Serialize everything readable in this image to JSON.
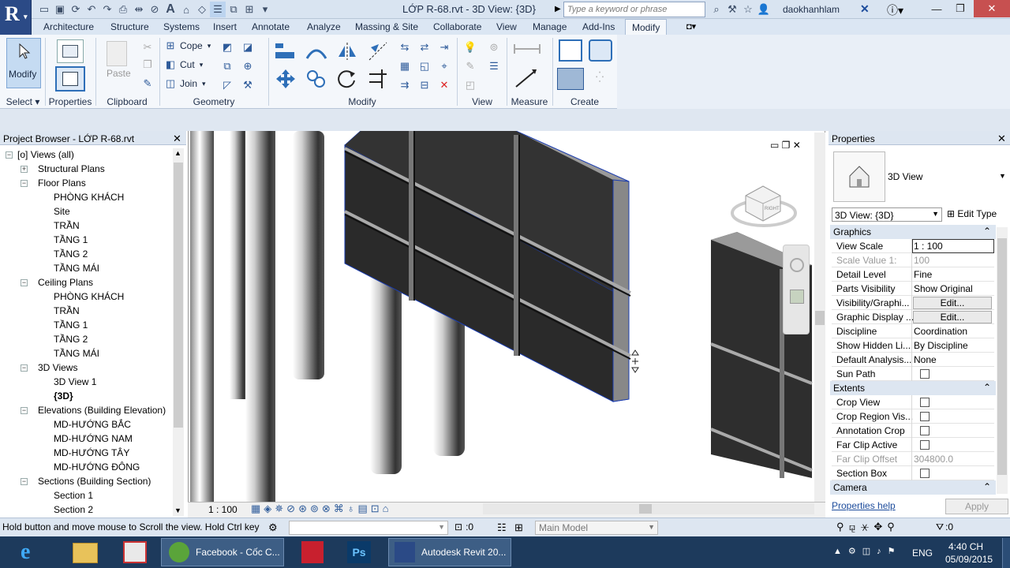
{
  "app": {
    "logo_letter": "R",
    "document_title": "LỚP R-68.rvt - 3D View: {3D}",
    "search_placeholder": "Type a keyword or phrase",
    "user": "daokhanhlam"
  },
  "tabs": [
    "Architecture",
    "Structure",
    "Systems",
    "Insert",
    "Annotate",
    "Analyze",
    "Massing & Site",
    "Collaborate",
    "View",
    "Manage",
    "Add-Ins",
    "Modify"
  ],
  "ribbon": {
    "modify_label": "Modify",
    "properties_label": "Properties",
    "paste_label": "Paste",
    "cope": "Cope",
    "cut": "Cut",
    "join": "Join",
    "panels": {
      "select": "Select ▾",
      "properties": "Properties",
      "clipboard": "Clipboard",
      "geometry": "Geometry",
      "modify": "Modify",
      "view": "View",
      "measure": "Measure",
      "create": "Create"
    }
  },
  "project_browser": {
    "title": "Project Browser - LỚP R-68.rvt",
    "items": [
      "Views (all)",
      "Structural Plans",
      "Floor Plans",
      "PHÒNG KHÁCH",
      "Site",
      "TRẦN",
      "TẦNG 1",
      "TẦNG 2",
      "TẦNG MÁI",
      "Ceiling Plans",
      "PHÒNG KHÁCH",
      "TRẦN",
      "TẦNG 1",
      "TẦNG 2",
      "TẦNG MÁI",
      "3D Views",
      "3D View 1",
      "{3D}",
      "Elevations (Building Elevation)",
      "MD-HƯỚNG BẮC",
      "MD-HƯỚNG NAM",
      "MD-HƯỚNG TÂY",
      "MD-HƯỚNG ĐÔNG",
      "Sections (Building Section)",
      "Section 1",
      "Section 2"
    ]
  },
  "viewport": {
    "scale": "1 : 100",
    "cube_label": "RIGHT"
  },
  "properties": {
    "title": "Properties",
    "type_name": "3D View",
    "instance_selector": "3D View: {3D}",
    "edit_type": "Edit Type",
    "cat_graphics": "Graphics",
    "cat_extents": "Extents",
    "cat_camera": "Camera",
    "rows": [
      {
        "k": "View Scale",
        "v": "1 : 100"
      },
      {
        "k": "Scale Value    1:",
        "v": "100"
      },
      {
        "k": "Detail Level",
        "v": "Fine"
      },
      {
        "k": "Parts Visibility",
        "v": "Show Original"
      },
      {
        "k": "Visibility/Graphi...",
        "v": "Edit..."
      },
      {
        "k": "Graphic Display ...",
        "v": "Edit..."
      },
      {
        "k": "Discipline",
        "v": "Coordination"
      },
      {
        "k": "Show Hidden Li...",
        "v": "By Discipline"
      },
      {
        "k": "Default Analysis...",
        "v": "None"
      },
      {
        "k": "Sun Path",
        "v": ""
      },
      {
        "k": "Crop View",
        "v": ""
      },
      {
        "k": "Crop Region Vis...",
        "v": ""
      },
      {
        "k": "Annotation Crop",
        "v": ""
      },
      {
        "k": "Far Clip Active",
        "v": ""
      },
      {
        "k": "Far Clip Offset",
        "v": "304800.0"
      },
      {
        "k": "Section Box",
        "v": ""
      }
    ],
    "help": "Properties help",
    "apply": "Apply"
  },
  "status": {
    "message": "Hold button and move mouse to Scroll the view. Hold Ctrl key",
    "count": ":0",
    "workset": "Main Model",
    "filter_count": ":0"
  },
  "taskbar": {
    "facebook": "Facebook - Cốc C...",
    "revit": "Autodesk Revit 20...",
    "lang": "ENG",
    "time": "4:40 CH",
    "date": "05/09/2015"
  }
}
